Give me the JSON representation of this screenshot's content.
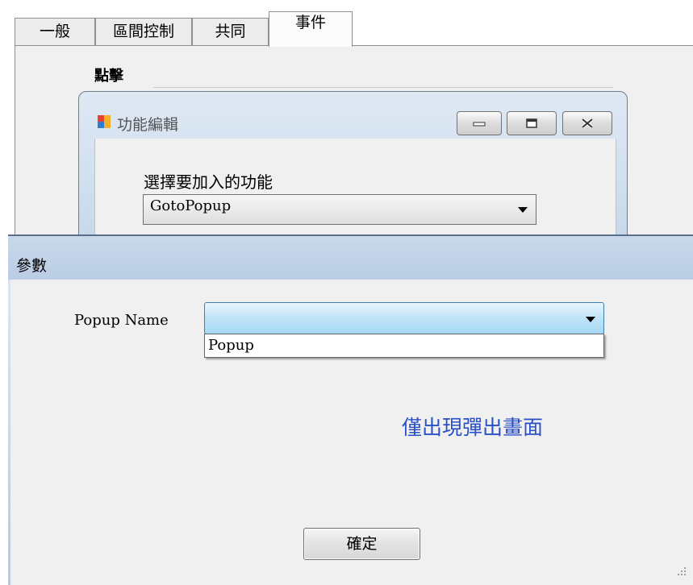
{
  "tabs": [
    {
      "label": "一般"
    },
    {
      "label": "區間控制"
    },
    {
      "label": "共同"
    },
    {
      "label": "事件"
    }
  ],
  "event_section": {
    "label": "點擊"
  },
  "function_editor": {
    "title": "功能編輯",
    "choose_label": "選擇要加入的功能",
    "function_selected": "GotoPopup"
  },
  "parameters_dialog": {
    "title": "參數",
    "popup_name_label": "Popup Name",
    "popup_name_value": "",
    "popup_options": [
      "Popup"
    ],
    "note": "僅出現彈出畫面",
    "ok_label": "確定"
  },
  "icons": {
    "window_icon": "app-window-icon",
    "minimize": "minimize-icon",
    "maximize": "maximize-icon",
    "close": "close-icon",
    "dropdown": "chevron-down-icon",
    "grip": "resize-grip-icon"
  },
  "colors": {
    "note_text": "#2a50c8",
    "titlebar": "#c9d8ea",
    "selected_combo": "#bfe3f8"
  }
}
